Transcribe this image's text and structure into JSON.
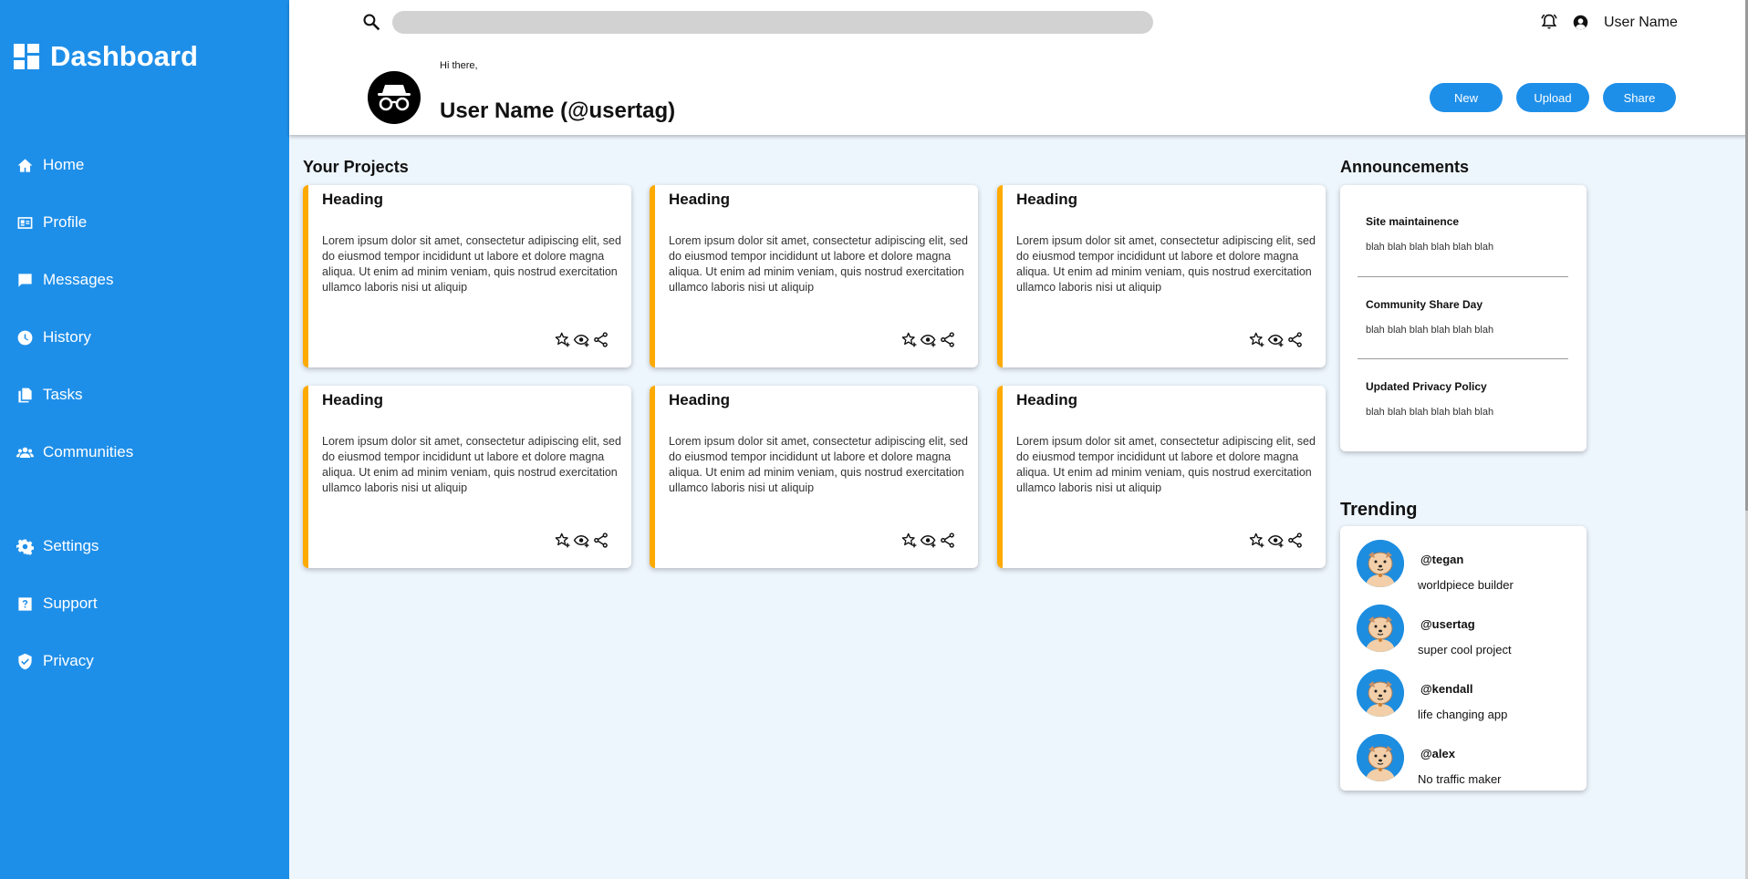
{
  "sidebar": {
    "title": "Dashboard",
    "items": [
      {
        "label": "Home",
        "icon": "home-icon"
      },
      {
        "label": "Profile",
        "icon": "id-card-icon"
      },
      {
        "label": "Messages",
        "icon": "message-icon"
      },
      {
        "label": "History",
        "icon": "clock-icon"
      },
      {
        "label": "Tasks",
        "icon": "copy-icon"
      },
      {
        "label": "Communities",
        "icon": "people-icon"
      },
      {
        "label": "Settings",
        "icon": "gear-icon"
      },
      {
        "label": "Support",
        "icon": "help-icon"
      },
      {
        "label": "Privacy",
        "icon": "shield-icon"
      }
    ]
  },
  "header": {
    "search_placeholder": "",
    "user_name": "User Name",
    "greeting": "Hi there,",
    "profile_name": "User Name (@usertag)",
    "buttons": {
      "new": "New",
      "upload": "Upload",
      "share": "Share"
    }
  },
  "projects": {
    "title": "Your Projects",
    "cards": [
      {
        "heading": "Heading",
        "body": "Lorem ipsum dolor sit amet, consectetur adipiscing elit, sed do eiusmod tempor incididunt ut labore et dolore magna aliqua. Ut enim ad minim veniam, quis nostrud exercitation ullamco laboris nisi ut aliquip"
      },
      {
        "heading": "Heading",
        "body": "Lorem ipsum dolor sit amet, consectetur adipiscing elit, sed do eiusmod tempor incididunt ut labore et dolore magna aliqua. Ut enim ad minim veniam, quis nostrud exercitation ullamco laboris nisi ut aliquip"
      },
      {
        "heading": "Heading",
        "body": "Lorem ipsum dolor sit amet, consectetur adipiscing elit, sed do eiusmod tempor incididunt ut labore et dolore magna aliqua. Ut enim ad minim veniam, quis nostrud exercitation ullamco laboris nisi ut aliquip"
      },
      {
        "heading": "Heading",
        "body": "Lorem ipsum dolor sit amet, consectetur adipiscing elit, sed do eiusmod tempor incididunt ut labore et dolore magna aliqua. Ut enim ad minim veniam, quis nostrud exercitation ullamco laboris nisi ut aliquip"
      },
      {
        "heading": "Heading",
        "body": "Lorem ipsum dolor sit amet, consectetur adipiscing elit, sed do eiusmod tempor incididunt ut labore et dolore magna aliqua. Ut enim ad minim veniam, quis nostrud exercitation ullamco laboris nisi ut aliquip"
      },
      {
        "heading": "Heading",
        "body": "Lorem ipsum dolor sit amet, consectetur adipiscing elit, sed do eiusmod tempor incididunt ut labore et dolore magna aliqua. Ut enim ad minim veniam, quis nostrud exercitation ullamco laboris nisi ut aliquip"
      }
    ]
  },
  "announcements": {
    "title": "Announcements",
    "items": [
      {
        "title": "Site maintainence",
        "text": "blah blah blah blah blah blah"
      },
      {
        "title": "Community Share Day",
        "text": "blah blah blah blah blah blah"
      },
      {
        "title": "Updated Privacy Policy",
        "text": "blah blah blah blah blah blah"
      }
    ]
  },
  "trending": {
    "title": "Trending",
    "items": [
      {
        "handle": "@tegan",
        "desc": "worldpiece builder"
      },
      {
        "handle": "@usertag",
        "desc": "super cool project"
      },
      {
        "handle": "@kendall",
        "desc": "life changing app"
      },
      {
        "handle": "@alex",
        "desc": "No traffic maker"
      }
    ]
  },
  "colors": {
    "sidebar": "#1e8fe9",
    "accent": "#ffaa00",
    "background": "#eef6fd"
  }
}
